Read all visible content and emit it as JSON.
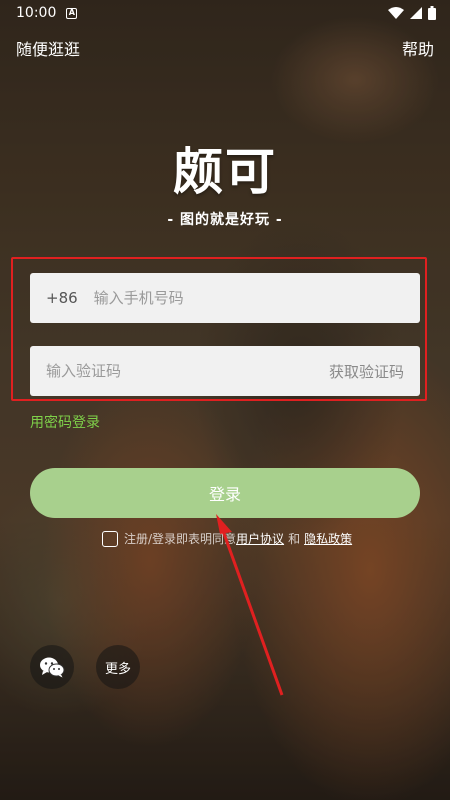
{
  "status_bar": {
    "time": "10:00",
    "icons": [
      "notification-icon",
      "wifi-icon",
      "signal-icon",
      "battery-icon"
    ]
  },
  "top_bar": {
    "left_label": "随便逛逛",
    "right_label": "帮助"
  },
  "brand": {
    "logo_text": "颇可",
    "slogan": "- 图的就是好玩 -"
  },
  "form": {
    "country_code": "+86",
    "phone_placeholder": "输入手机号码",
    "code_placeholder": "输入验证码",
    "get_code_label": "获取验证码",
    "password_login_label": "用密码登录",
    "login_button_label": "登录"
  },
  "agreement": {
    "prefix_text": "注册/登录即表明同意",
    "user_agreement_label": "用户协议",
    "and_text": "和",
    "privacy_policy_label": "隐私政策",
    "checked": false
  },
  "bottom": {
    "wechat_icon": "wechat-icon",
    "more_label": "更多"
  },
  "colors": {
    "accent_green": "#7fd14a",
    "login_button": "#a8d08d",
    "annotation_red": "#e02020"
  }
}
